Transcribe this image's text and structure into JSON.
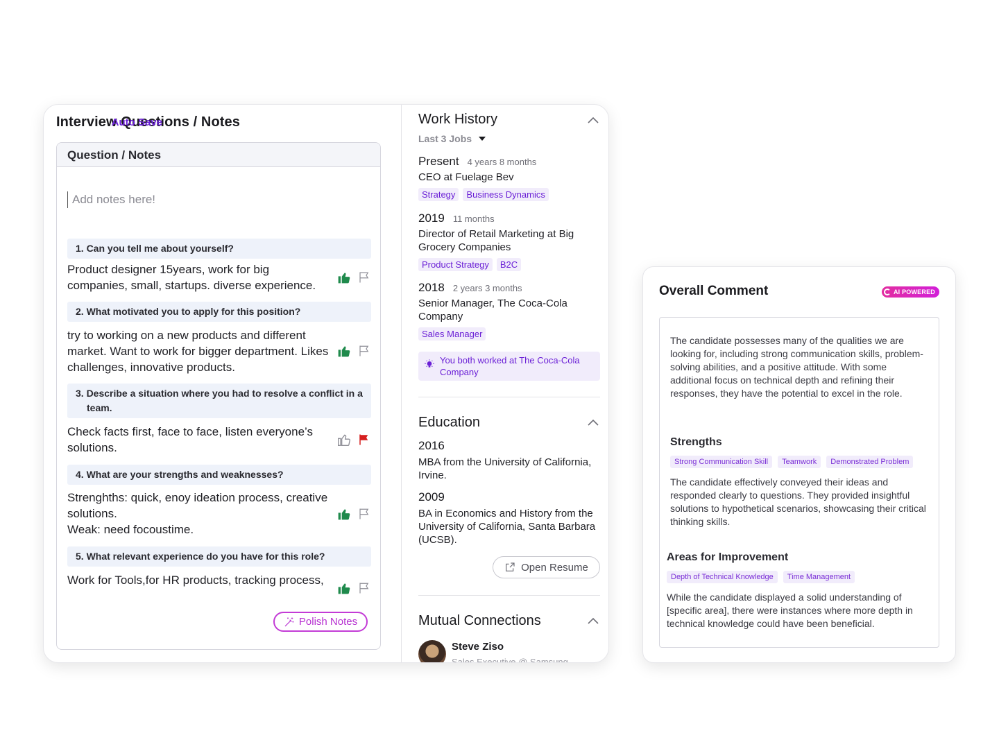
{
  "interview": {
    "title": "Interview Questions / Notes",
    "auto_save": "Auto Save",
    "notes_header": "Question / Notes",
    "notes_placeholder": "Add notes here!",
    "questions": [
      {
        "q": "1. Can you tell me about yourself?",
        "a": "Product designer 15years, work for big companies, small, startups. diverse experience.",
        "thumbs_up": true,
        "flagged": false
      },
      {
        "q": "2. What motivated you to apply for this position?",
        "a": "try to working on a new products and different market. Want to work for bigger department. Likes challenges, innovative products.",
        "thumbs_up": true,
        "flagged": false
      },
      {
        "q": "3. Describe a situation where you had to resolve a conflict in a team.",
        "a": "Check facts first, face to face, listen everyone’s solutions.",
        "thumbs_up": false,
        "flagged": true
      },
      {
        "q": "4. What are your strengths and weaknesses?",
        "a_lines": [
          "Strenghths: quick, enoy ideation process, creative solutions.",
          "Weak: need focoustime."
        ],
        "thumbs_up": true,
        "flagged": false
      },
      {
        "q": "5. What relevant experience do you have for this role?",
        "a": "Work for Tools,for HR products, tracking process,",
        "thumbs_up": true,
        "flagged": false
      }
    ],
    "polish_button": "Polish Notes"
  },
  "work_history": {
    "title": "Work History",
    "filter": "Last 3 Jobs",
    "jobs": [
      {
        "year": "Present",
        "duration": "4 years 8 months",
        "title": "CEO at Fuelage Bev",
        "tags": [
          "Strategy",
          "Business Dynamics"
        ]
      },
      {
        "year": "2019",
        "duration": "11 months",
        "title": "Director of Retail Marketing at Big Grocery Companies",
        "tags": [
          "Product Strategy",
          "B2C"
        ]
      },
      {
        "year": "2018",
        "duration": "2 years 3 months",
        "title": "Senior Manager, The Coca-Cola Company",
        "tags": [
          "Sales Manager"
        ]
      }
    ],
    "shared_note": "You both worked at The Coca-Cola Company"
  },
  "education": {
    "title": "Education",
    "items": [
      {
        "year": "2016",
        "text": "MBA from the University of California, Irvine."
      },
      {
        "year": "2009",
        "text": "BA in Economics and History from the University of California, Santa Barbara (UCSB)."
      }
    ],
    "open_resume": "Open Resume"
  },
  "connections": {
    "title": "Mutual Connections",
    "people": [
      {
        "name": "Steve Ziso",
        "role": "Sales Executive @ Samsung"
      }
    ]
  },
  "overall": {
    "title": "Overall Comment",
    "badge": "AI POWERED",
    "summary": "The candidate possesses many of the qualities we are looking for, including strong communication skills, problem-solving abilities, and a positive attitude. With some additional focus on technical depth and refining their responses, they have the potential to excel in the role.",
    "strengths_title": "Strengths",
    "strengths_tags": [
      "Strong Communication Skill",
      "Teamwork",
      "Demonstrated Problem"
    ],
    "strengths_text": "The candidate effectively conveyed their ideas and responded clearly to questions. They provided insightful solutions to hypothetical scenarios, showcasing their critical thinking skills.",
    "improve_title": "Areas for Improvement",
    "improve_tags": [
      "Depth of Technical Knowledge",
      "Time Management"
    ],
    "improve_text": "While the candidate displayed a solid understanding of [specific area], there were instances where more depth in technical knowledge could have been beneficial."
  },
  "colors": {
    "accent": "#6a1fd6",
    "thumb_green": "#1f8a4c",
    "flag_red": "#d61f1f",
    "tag_bg": "#f1ecfb",
    "ai_pink": "#e22ea0"
  }
}
